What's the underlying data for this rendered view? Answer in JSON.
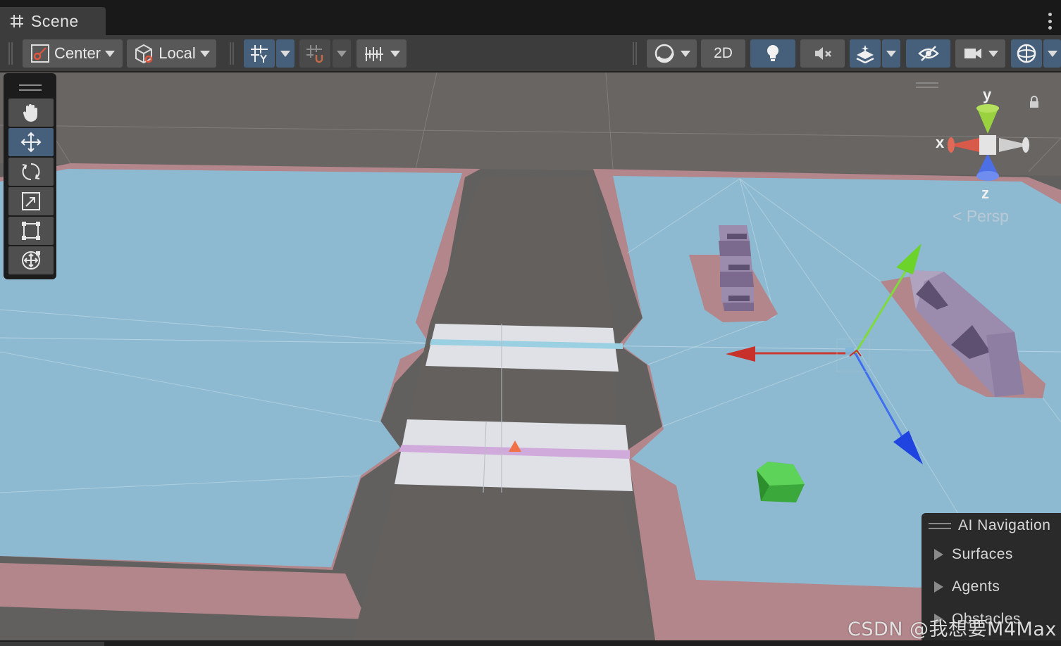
{
  "tab": {
    "title": "Scene",
    "grid_icon": "grid-icon",
    "menu_icon": "kebab-menu-icon"
  },
  "toolbar": {
    "pivot_label": "Center",
    "space_label": "Local",
    "mode_2d_label": "2D",
    "icons": [
      "pivot-icon",
      "local-cube-icon",
      "grid-snap-icon",
      "increment-snap-icon",
      "ruler-icon",
      "shading-sphere-icon",
      "lightbulb-icon",
      "audio-mute-icon",
      "effects-icon",
      "hidden-objects-icon",
      "camera-icon",
      "gizmos-icon"
    ]
  },
  "tools": [
    "hand-tool",
    "move-tool",
    "rotate-tool",
    "scale-tool",
    "rect-tool",
    "transform-tool"
  ],
  "gizmo": {
    "y_label": "y",
    "x_label": "x",
    "z_label": "z",
    "projection_label": "Persp"
  },
  "ai_navigation": {
    "title": "AI Navigation",
    "items": [
      "Surfaces",
      "Agents",
      "Obstacles"
    ]
  },
  "watermark": "CSDN @我想要M4Max",
  "colors": {
    "navmesh_blue": "#8dbad1",
    "border_pink": "#b3868b",
    "ground_gray": "#62605e",
    "crossing_white": "#dfe1e6",
    "axis_x": "#d0392e",
    "axis_y": "#7dd43a",
    "axis_z": "#2e5fe8",
    "accent_button": "#46607c"
  }
}
